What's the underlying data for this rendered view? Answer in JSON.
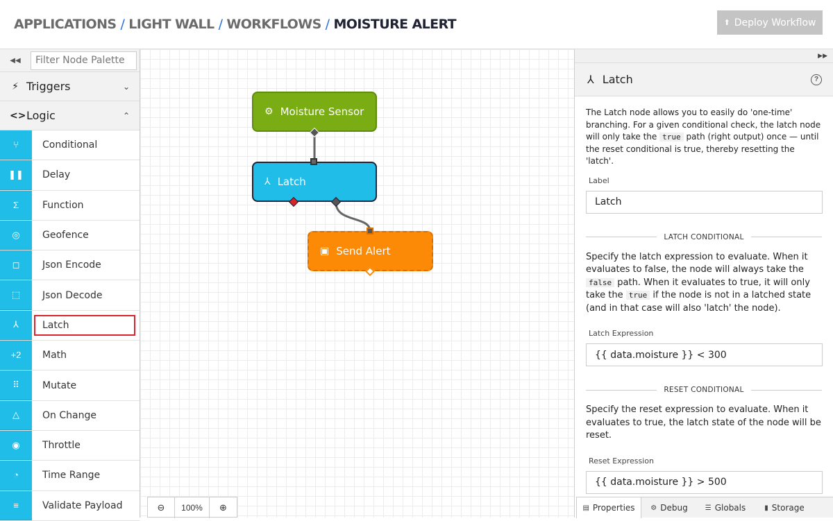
{
  "header": {
    "breadcrumb": [
      "APPLICATIONS",
      "LIGHT WALL",
      "WORKFLOWS"
    ],
    "current": "MOISTURE ALERT",
    "separator": "/",
    "deploy_label": "Deploy Workflow"
  },
  "palette": {
    "filter_placeholder": "Filter Node Palette",
    "categories": {
      "triggers": "Triggers",
      "logic": "Logic"
    },
    "items": [
      "Conditional",
      "Delay",
      "Function",
      "Geofence",
      "Json Encode",
      "Json Decode",
      "Latch",
      "Math",
      "Mutate",
      "On Change",
      "Throttle",
      "Time Range",
      "Validate Payload"
    ],
    "selected": "Latch",
    "accent_color": "#20bde8"
  },
  "canvas": {
    "nodes": {
      "moisture": "Moisture Sensor",
      "latch": "Latch",
      "alert": "Send Alert"
    },
    "zoom_level": "100%",
    "colors": {
      "sensor": "#7aad13",
      "logic": "#20bde8",
      "output": "#fd8a07"
    }
  },
  "panel": {
    "title": "Latch",
    "intro_parts": [
      "The Latch node allows you to easily do 'one-time' branching. For a given conditional check, the latch node will only take the ",
      "true",
      " path (right output) once — until the reset conditional is true, thereby resetting the 'latch'."
    ],
    "label_field_label": "Label",
    "label_value": "Latch",
    "latch_section": "LATCH CONDITIONAL",
    "latch_desc_parts": [
      "Specify the latch expression to evaluate. When it evaluates to false, the node will always take the ",
      "false",
      " path. When it evaluates to true, it will only take the ",
      "true",
      " if the node is not in a latched state (and in that case will also 'latch' the node)."
    ],
    "latch_expr_label": "Latch Expression",
    "latch_expr_value": "{{ data.moisture }} < 300",
    "reset_section": "RESET CONDITIONAL",
    "reset_desc": "Specify the reset expression to evaluate. When it evaluates to true, the latch state of the node will be reset.",
    "reset_expr_label": "Reset Expression",
    "reset_expr_value": "{{ data.moisture }} > 500",
    "tabs": [
      "Properties",
      "Debug",
      "Globals",
      "Storage"
    ],
    "active_tab": "Properties"
  }
}
